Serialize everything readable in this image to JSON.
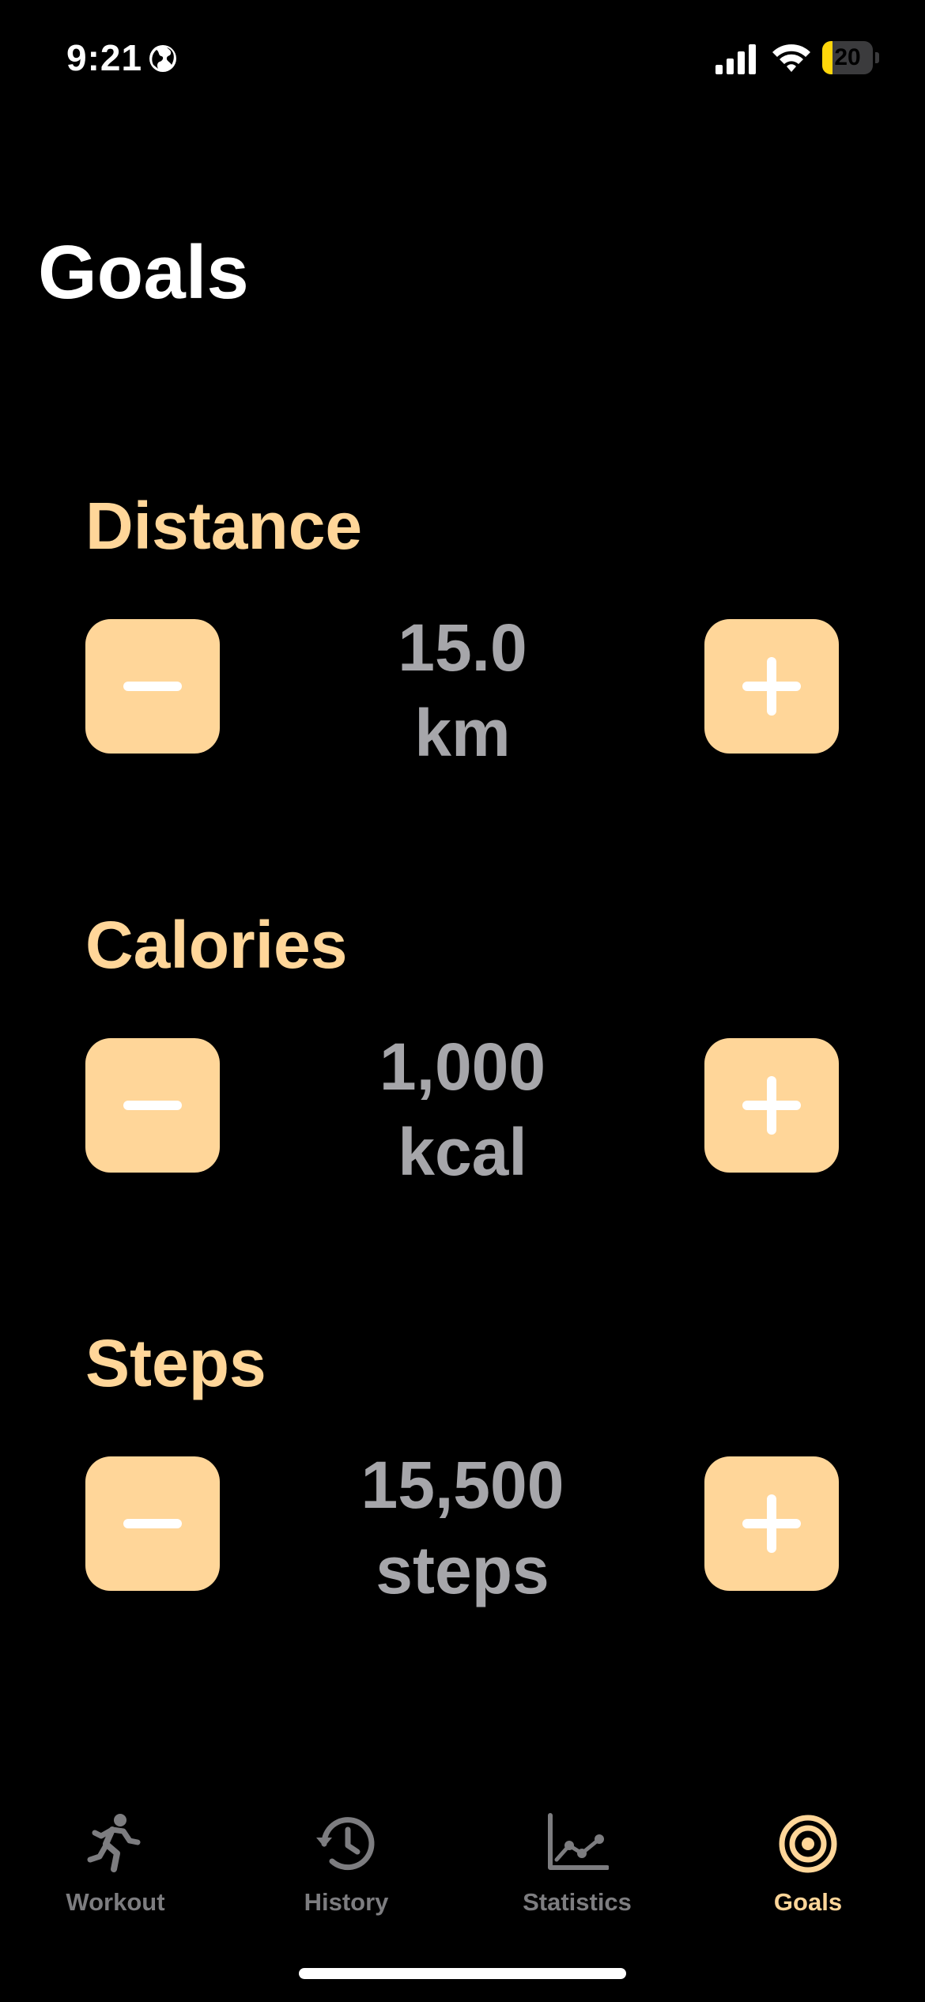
{
  "status_bar": {
    "time": "9:21",
    "battery_level": "20",
    "battery_fraction": 0.2,
    "icons": [
      "globe-icon",
      "cellular-signal-icon",
      "wifi-icon",
      "battery-icon"
    ]
  },
  "title": "Goals",
  "goals": [
    {
      "label": "Distance",
      "value": "15.0",
      "unit": "km"
    },
    {
      "label": "Calories",
      "value": "1,000",
      "unit": "kcal"
    },
    {
      "label": "Steps",
      "value": "15,500",
      "unit": "steps"
    }
  ],
  "tabs": [
    {
      "label": "Workout",
      "icon": "running-figure-icon",
      "active": false
    },
    {
      "label": "History",
      "icon": "clock-history-icon",
      "active": false
    },
    {
      "label": "Statistics",
      "icon": "line-chart-icon",
      "active": false
    },
    {
      "label": "Goals",
      "icon": "target-icon",
      "active": true
    }
  ],
  "colors": {
    "accent": "#ffd699",
    "value_text": "#a6a6aa",
    "inactive_tab": "#7d7d80",
    "background": "#000000",
    "battery_fill": "#ffd60a"
  }
}
